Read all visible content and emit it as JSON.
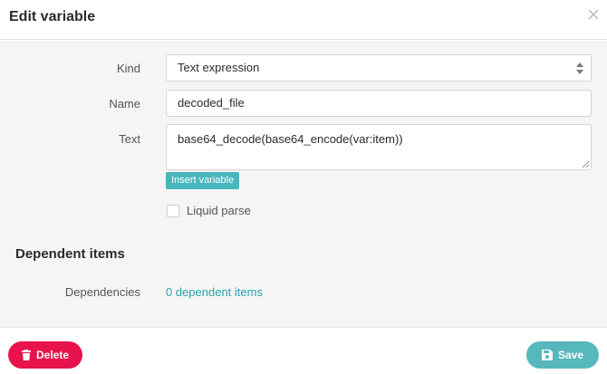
{
  "dialog": {
    "title": "Edit variable"
  },
  "form": {
    "kind_label": "Kind",
    "kind_value": "Text expression",
    "name_label": "Name",
    "name_value": "decoded_file",
    "text_label": "Text",
    "text_value": "base64_decode(base64_encode(var:item))",
    "insert_variable_label": "Insert variable",
    "liquid_parse_label": "Liquid parse",
    "liquid_parse_checked": false
  },
  "dependent_section": {
    "title": "Dependent items",
    "dependencies_label": "Dependencies",
    "dependencies_link": "0 dependent items"
  },
  "footer": {
    "delete_label": "Delete",
    "save_label": "Save"
  },
  "icons": {
    "close": "close-icon",
    "select_arrows": "sort-arrows-icon",
    "trash": "trash-icon",
    "save": "floppy-disk-icon"
  },
  "colors": {
    "delete": "#e8134c",
    "save": "#56b8bd",
    "accent": "#49b6bd",
    "link": "#2aa3ad"
  }
}
